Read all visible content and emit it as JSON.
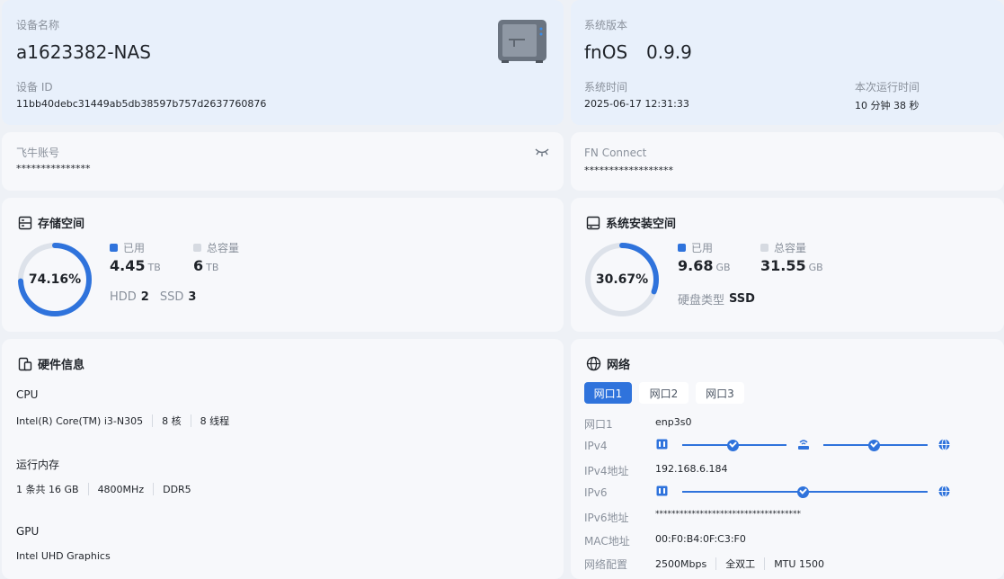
{
  "device": {
    "name_label": "设备名称",
    "name": "a1623382-NAS",
    "id_label": "设备 ID",
    "id": "11bb40debc31449ab5db38597b757d2637760876"
  },
  "system": {
    "version_label": "系统版本",
    "version_name": "fnOS",
    "version_num": "0.9.9",
    "time_label": "系统时间",
    "time": "2025-06-17 12:31:33",
    "uptime_label": "本次运行时间",
    "uptime": "10 分钟 38 秒"
  },
  "account": {
    "label": "飞牛账号",
    "value": "***************"
  },
  "fn_connect": {
    "label": "FN Connect",
    "value": "******************"
  },
  "storage": {
    "title": "存储空间",
    "percent_text": "74.16%",
    "percent": 74.16,
    "used_label": "已用",
    "used_value": "4.45",
    "used_unit": "TB",
    "total_label": "总容量",
    "total_value": "6",
    "total_unit": "TB",
    "hdd_label": "HDD",
    "hdd_count": "2",
    "ssd_label": "SSD",
    "ssd_count": "3"
  },
  "system_storage": {
    "title": "系统安装空间",
    "percent_text": "30.67%",
    "percent": 30.67,
    "used_label": "已用",
    "used_value": "9.68",
    "used_unit": "GB",
    "total_label": "总容量",
    "total_value": "31.55",
    "total_unit": "GB",
    "disk_type_label": "硬盘类型",
    "disk_type": "SSD"
  },
  "hardware": {
    "title": "硬件信息",
    "cpu_label": "CPU",
    "cpu_model": "Intel(R) Core(TM) i3-N305",
    "cpu_cores": "8 核",
    "cpu_threads": "8 线程",
    "mem_label": "运行内存",
    "mem_size": "1 条共 16 GB",
    "mem_freq": "4800MHz",
    "mem_type": "DDR5",
    "gpu_label": "GPU",
    "gpu_model": "Intel UHD Graphics"
  },
  "network": {
    "title": "网络",
    "tabs": [
      "网口1",
      "网口2",
      "网口3"
    ],
    "iface_label": "网口1",
    "iface": "enp3s0",
    "ipv4_label": "IPv4",
    "ipv4_addr_label": "IPv4地址",
    "ipv4_addr": "192.168.6.184",
    "ipv6_label": "IPv6",
    "ipv6_addr_label": "IPv6地址",
    "ipv6_addr": "************************************",
    "mac_label": "MAC地址",
    "mac": "00:F0:B4:0F:C3:F0",
    "config_label": "网络配置",
    "speed": "2500Mbps",
    "duplex": "全双工",
    "mtu": "MTU 1500"
  },
  "colors": {
    "accent": "#2f73dc",
    "track": "#dde2ea"
  },
  "icons": [
    "nas-device-icon",
    "eye-closed-icon",
    "storage-icon",
    "disk-icon",
    "hardware-icon",
    "globe-icon",
    "lan-port-icon",
    "router-icon"
  ]
}
